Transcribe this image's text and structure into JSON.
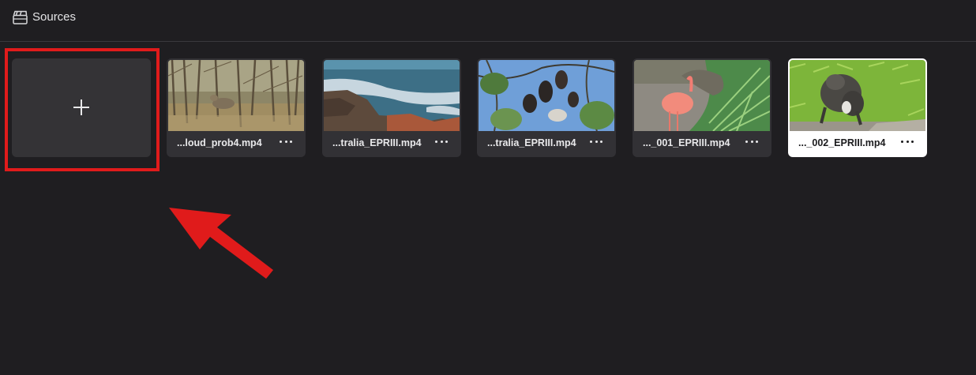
{
  "header": {
    "icon": "clapperboard-icon",
    "title": "Sources"
  },
  "add_tile": {
    "icon": "plus-icon",
    "highlight_color": "#e01b1b"
  },
  "sources": [
    {
      "filename": "...loud_prob4.mp4",
      "thumbnail": "deer-in-forest",
      "selected": false
    },
    {
      "filename": "...tralia_EPRIII.mp4",
      "thumbnail": "rocky-coastline",
      "selected": false
    },
    {
      "filename": "...tralia_EPRIII.mp4",
      "thumbnail": "bats-in-tree",
      "selected": false
    },
    {
      "filename": "..._001_EPRIII.mp4",
      "thumbnail": "flamingo",
      "selected": false
    },
    {
      "filename": "..._002_EPRIII.mp4",
      "thumbnail": "lemur-on-grass",
      "selected": true
    }
  ],
  "annotation": {
    "arrow_color": "#e01b1b"
  }
}
